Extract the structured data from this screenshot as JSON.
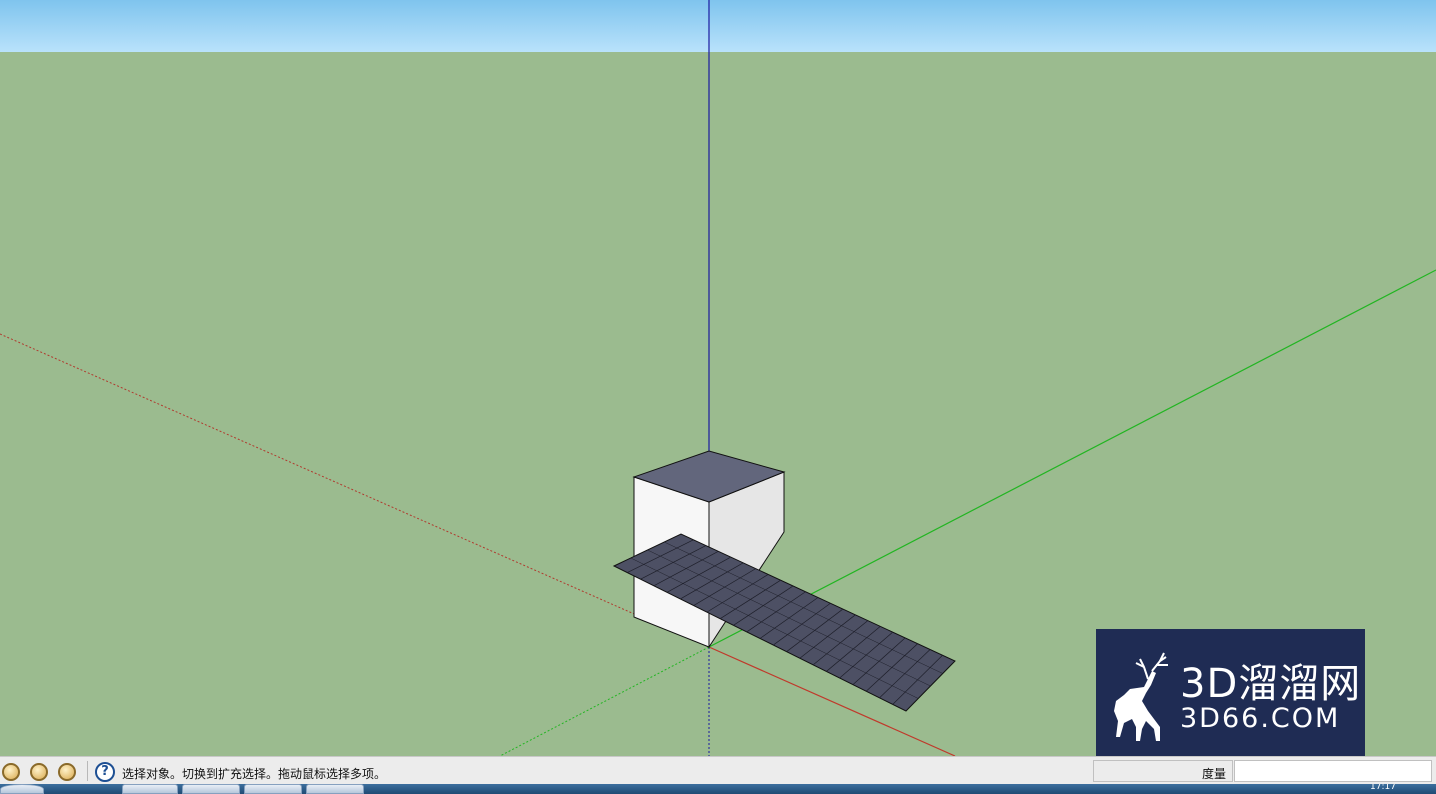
{
  "status_bar": {
    "tool_tips": [
      "?",
      "?",
      "?"
    ],
    "help_icon": "question-circle-icon",
    "status_message": "选择对象。切换到扩充选择。拖动鼠标选择多项。",
    "measurements_label": "度量",
    "measurements_value": ""
  },
  "taskbar": {
    "clock": "17:17"
  },
  "watermark": {
    "brand_name": "3D溜溜网",
    "brand_url": "3D66.COM",
    "logo_icon": "deer-logo-icon"
  },
  "colors": {
    "ground": "#9bbb8f",
    "sky": "#a7d8f5",
    "axis_red": "#c0392b",
    "axis_green": "#22b522",
    "axis_blue": "#1a1aa0",
    "box_top": "#62667c",
    "ramp": "#4d5064"
  }
}
